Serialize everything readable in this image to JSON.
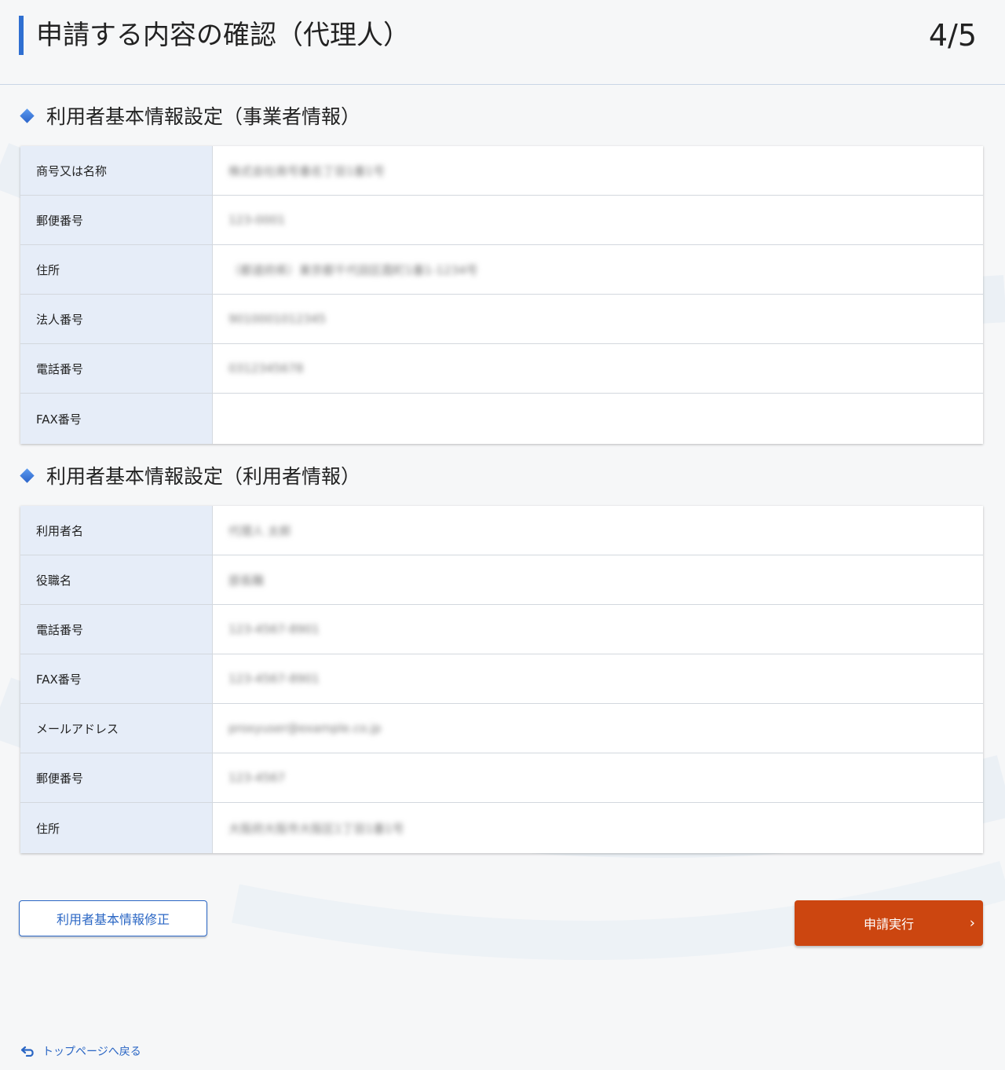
{
  "header": {
    "title": "申請する内容の確認（代理人）",
    "step": "4/5"
  },
  "business_section": {
    "title": "利用者基本情報設定（事業者情報）",
    "rows": [
      {
        "label": "商号又は名称",
        "value": "株式会社商号番名丁目1番1号"
      },
      {
        "label": "郵便番号",
        "value": "123-0001"
      },
      {
        "label": "住所",
        "value": "（都道府県）東京都千代田区霞町1番1-1234号"
      },
      {
        "label": "法人番号",
        "value": "9010001012345"
      },
      {
        "label": "電話番号",
        "value": "0312345678"
      },
      {
        "label": "FAX番号",
        "value": ""
      }
    ]
  },
  "user_section": {
    "title": "利用者基本情報設定（利用者情報）",
    "rows": [
      {
        "label": "利用者名",
        "value": "代理人 太郎"
      },
      {
        "label": "役職名",
        "value": "部長職"
      },
      {
        "label": "電話番号",
        "value": "123-4567-8901"
      },
      {
        "label": "FAX番号",
        "value": "123-4567-8901"
      },
      {
        "label": "メールアドレス",
        "value": "proxyuser@example.co.jp"
      },
      {
        "label": "郵便番号",
        "value": "123-4567"
      },
      {
        "label": "住所",
        "value": "大阪府大阪市大阪区1丁目1番1号"
      }
    ]
  },
  "buttons": {
    "edit": "利用者基本情報修正",
    "submit": "申請実行",
    "submit_chevron": "›"
  },
  "footer": {
    "back_link": "トップページへ戻る"
  },
  "colors": {
    "accent_blue": "#2f6fd1",
    "label_bg": "#e6edf8",
    "submit_orange": "#cc4610"
  }
}
